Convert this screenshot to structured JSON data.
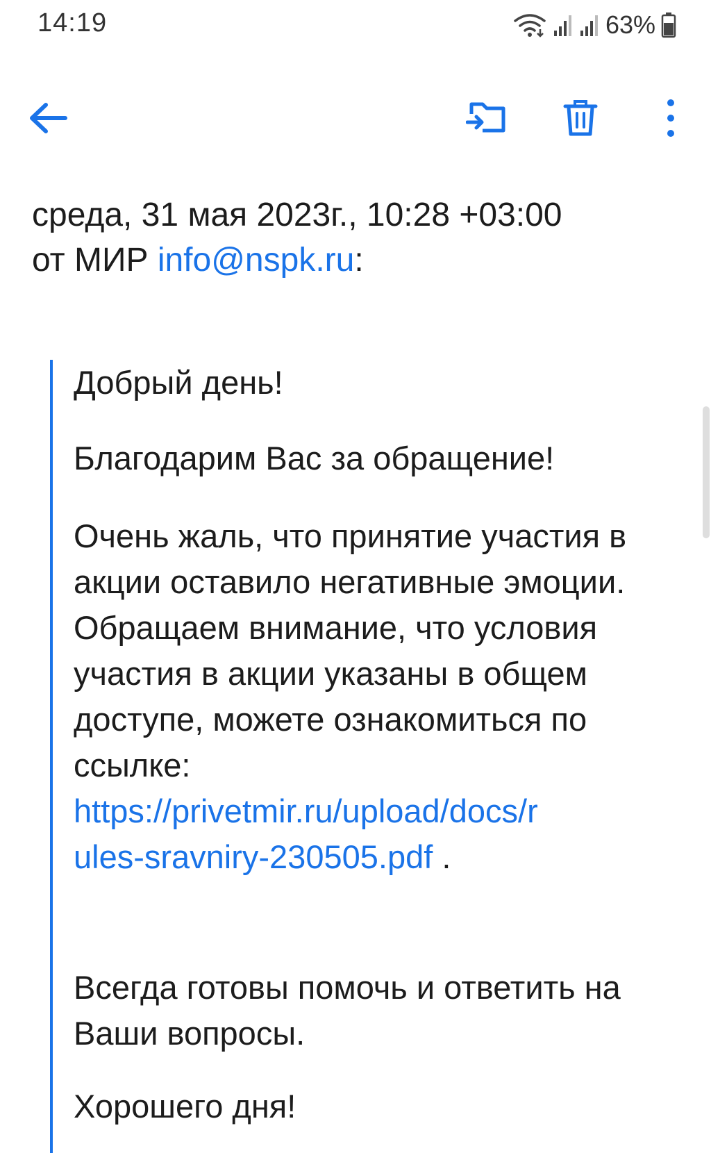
{
  "status_bar": {
    "time": "14:19",
    "battery": "63%",
    "icons": [
      "wifi-icon",
      "signal-icon",
      "signal-icon",
      "battery-icon"
    ]
  },
  "toolbar": {
    "icons": [
      "back-arrow-icon",
      "move-to-folder-icon",
      "trash-icon",
      "more-vertical-icon"
    ],
    "accent_color": "#1a73e8"
  },
  "email": {
    "date_line": "среда, 31 мая 2023г., 10:28 +03:00",
    "from_prefix": "от МИР",
    "from_email": "info@nspk.ru",
    "from_suffix": ":"
  },
  "body": {
    "greeting": "Добрый день!",
    "thanks": "Благодарим Вас за обращение!",
    "main_text": "Очень жаль, что принятие участия в акции оставило негативные эмоции. Обращаем внимание, что условия участия в акции указаны в общем доступе, можете ознакомиться по ссылке:",
    "link_line1": "https://privetmir.ru/upload/docs/r",
    "link_line2": "ules-sravniry-230505.pdf",
    "link_suffix": " .",
    "ready": "Всегда готовы помочь и ответить на Ваши вопросы.",
    "goodbye": "Хорошего дня!"
  }
}
